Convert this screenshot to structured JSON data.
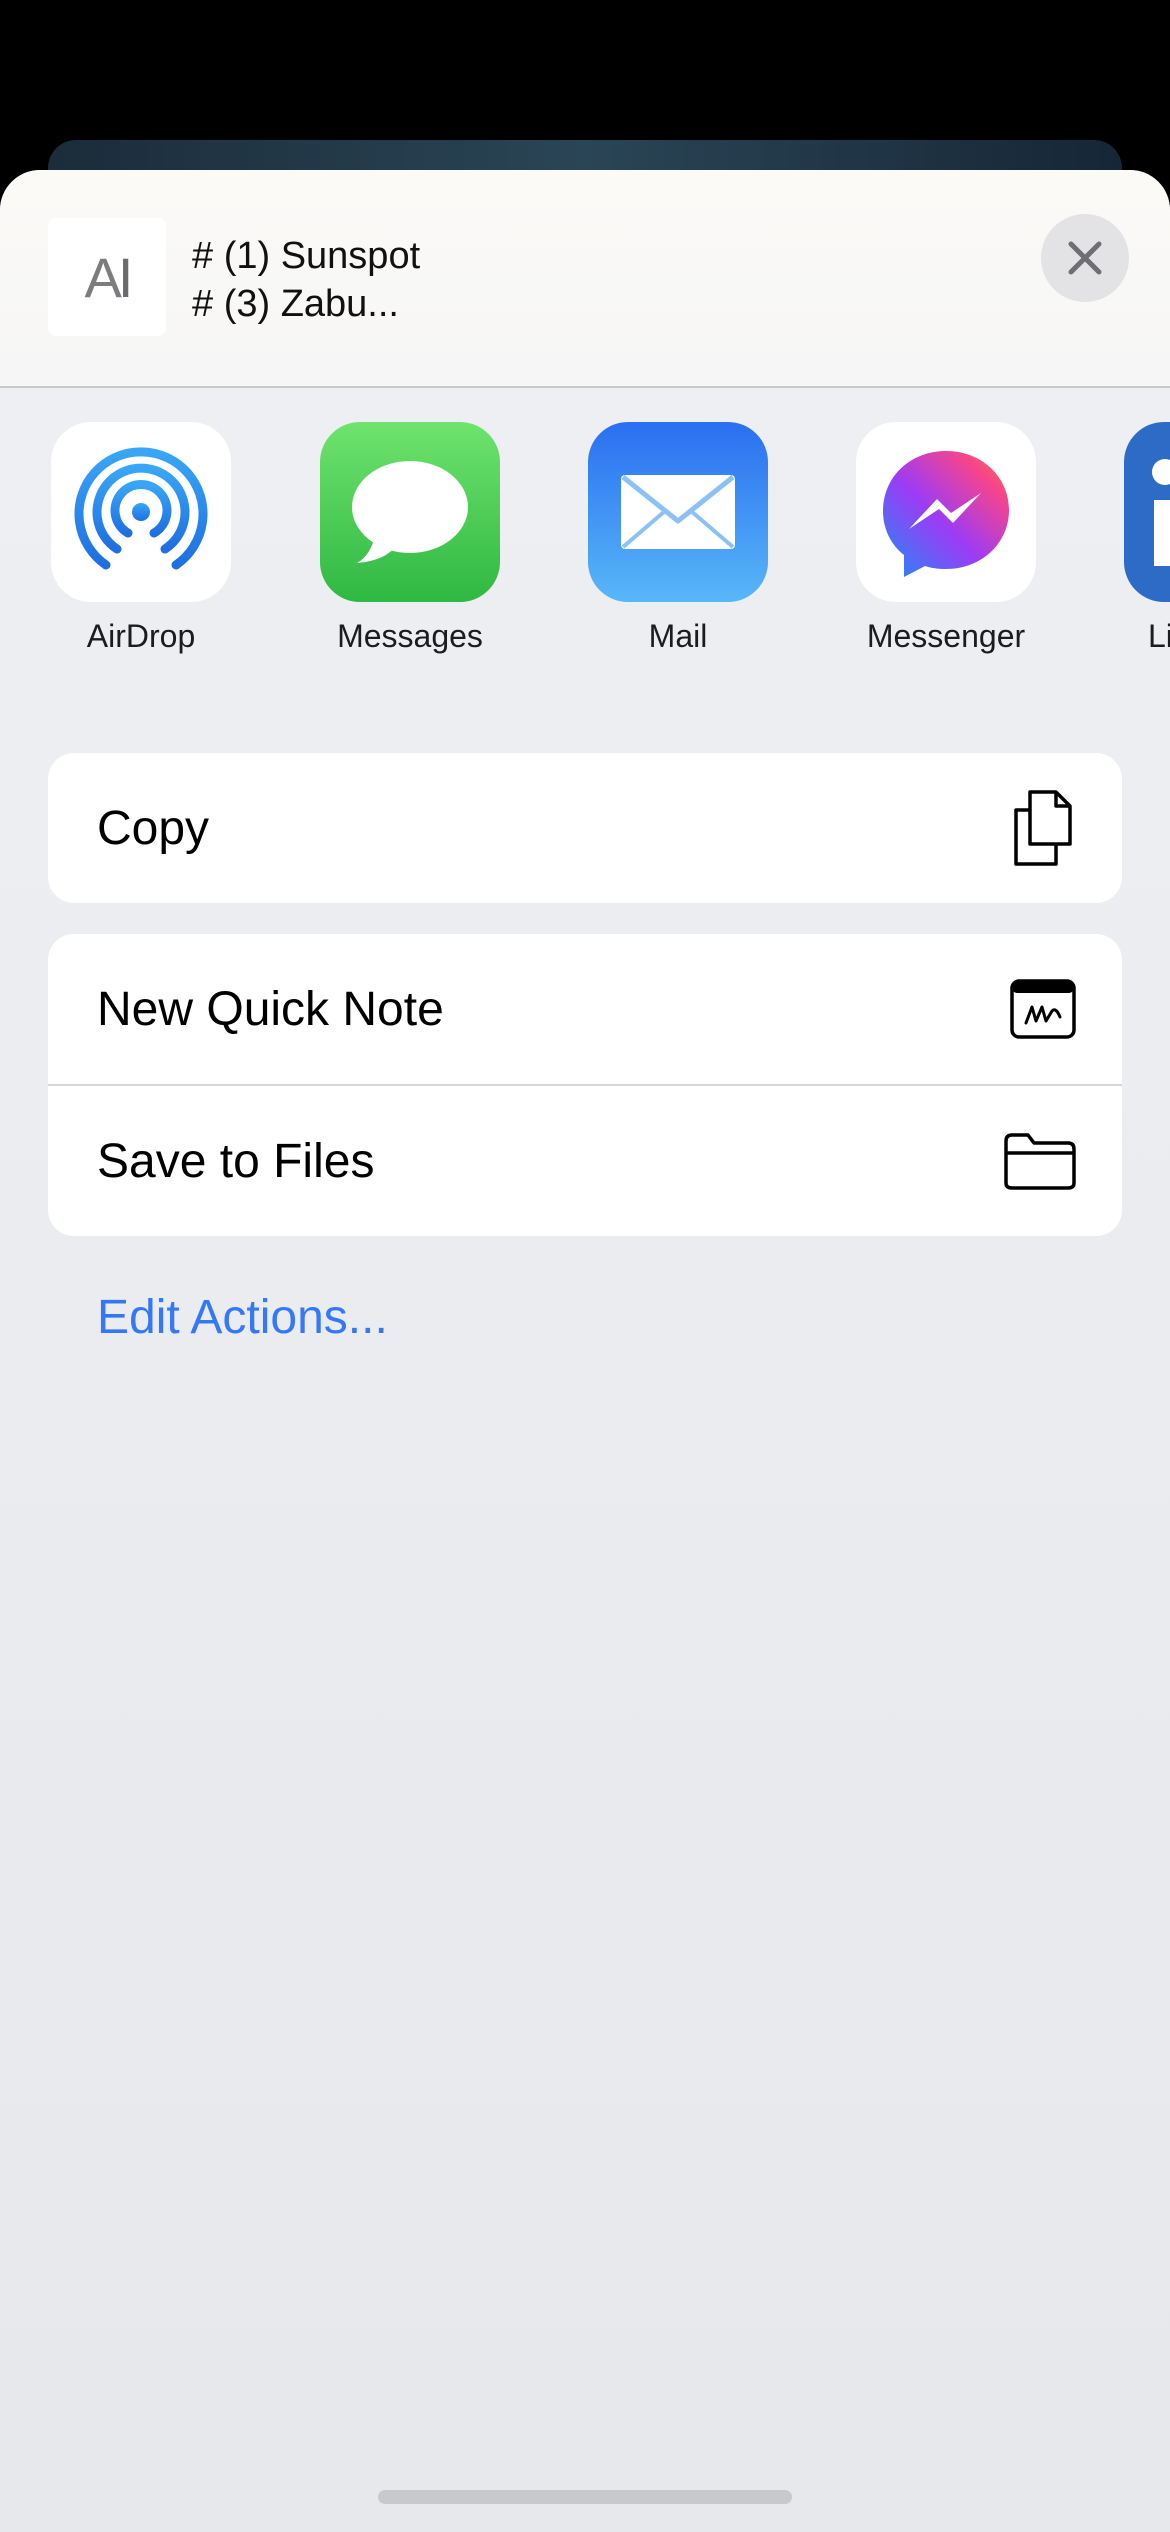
{
  "preview": {
    "thumb_text": "A",
    "thumb_cursor": "I",
    "line1": "# (1) Sunspot",
    "line2": "# (3) Zabu..."
  },
  "apps": [
    {
      "label": "AirDrop",
      "icon": "airdrop-icon"
    },
    {
      "label": "Messages",
      "icon": "messages-icon"
    },
    {
      "label": "Mail",
      "icon": "mail-icon"
    },
    {
      "label": "Messenger",
      "icon": "messenger-icon"
    },
    {
      "label": "Li",
      "icon": "linkedin-icon"
    }
  ],
  "actions": {
    "copy": {
      "label": "Copy",
      "icon": "copy-icon"
    },
    "quick_note": {
      "label": "New Quick Note",
      "icon": "quick-note-icon"
    },
    "save_files": {
      "label": "Save to Files",
      "icon": "folder-icon"
    }
  },
  "edit_actions_label": "Edit Actions...",
  "colors": {
    "accent": "#3478f6",
    "messages_green": "#34c759",
    "mail_blue": "#2f8cf5",
    "linkedin_blue": "#2e6bc6"
  }
}
